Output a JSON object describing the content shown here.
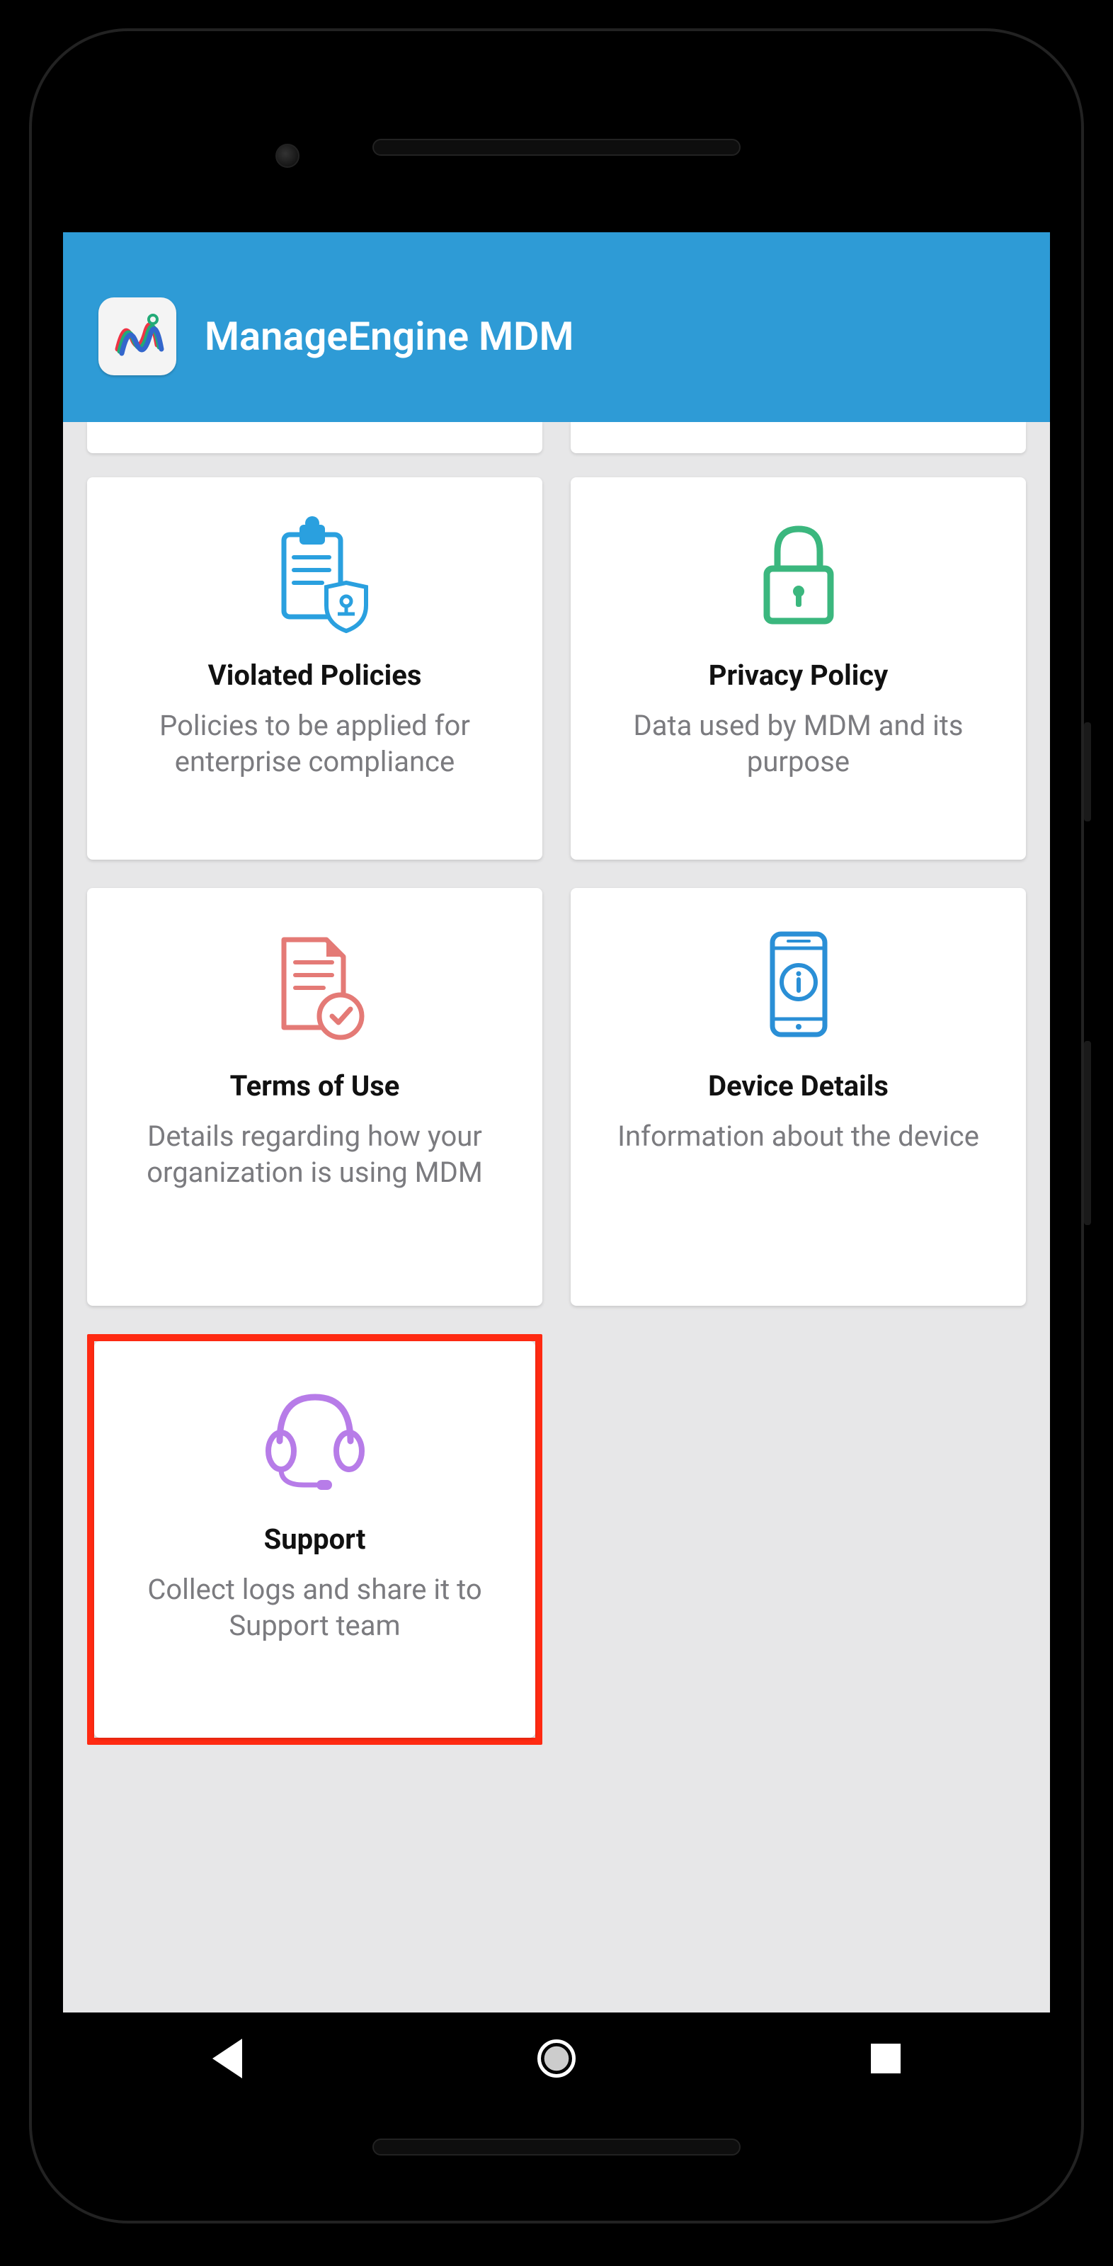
{
  "app": {
    "title": "ManageEngine MDM"
  },
  "cards": {
    "violated": {
      "title": "Violated Policies",
      "desc": "Policies to be applied for enterprise compliance"
    },
    "privacy": {
      "title": "Privacy Policy",
      "desc": "Data used by MDM and its purpose"
    },
    "terms": {
      "title": "Terms of Use",
      "desc": "Details regarding how your organization is using MDM"
    },
    "device": {
      "title": "Device Details",
      "desc": "Information about the device"
    },
    "support": {
      "title": "Support",
      "desc": "Collect logs and share it to Support team"
    }
  }
}
